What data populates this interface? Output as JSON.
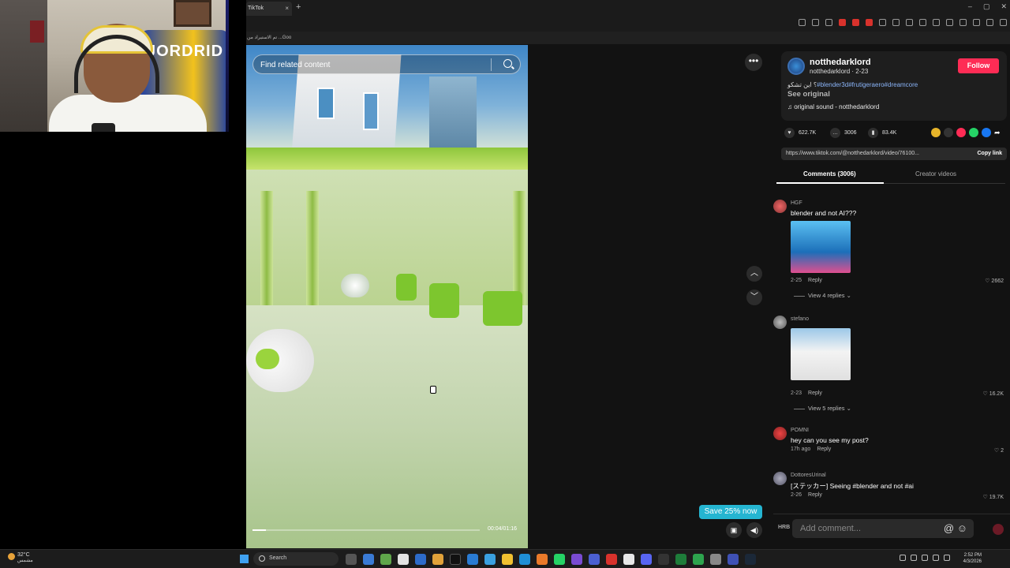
{
  "browser": {
    "tab_title": "TikTok",
    "tab_close": "×",
    "new_tab": "+",
    "window_controls": [
      "–",
      "▢",
      "✕"
    ],
    "bookmark_text": "تم الاستيراد من ...Goo"
  },
  "video": {
    "search_placeholder": "Find related content",
    "time": "00:04/01:16",
    "progress": 0.06
  },
  "controls": {
    "more": "•••",
    "up": "︿",
    "down": "﹀"
  },
  "post": {
    "display_name": "notthedarklord",
    "handle_line": "notthedarklord · 2-23",
    "follow_label": "Follow",
    "description_prefix": "؟ اين تشكو",
    "hashtags": "#blender3d#frutigeraero#dreamcore",
    "see_original": "See original",
    "sound": "♫  original sound - notthedarklord",
    "likes": "622.7K",
    "comments": "3006",
    "saves": "83.4K",
    "link": "https://www.tiktok.com/@notthedarklord/video/76100...",
    "copy_link": "Copy link"
  },
  "tabs": {
    "comments": "Comments (3006)",
    "creator_videos": "Creator videos"
  },
  "comments": [
    {
      "user": "HGF",
      "text": "blender and not AI???",
      "date": "2-25",
      "reply": "Reply",
      "likes": "2662",
      "replies": "View 4 replies ⌄"
    },
    {
      "user": "stefano",
      "text": "",
      "date": "2-23",
      "reply": "Reply",
      "likes": "16.2K",
      "replies": "View 5 replies ⌄"
    },
    {
      "user": "POMNI",
      "text": "hey can you see my post?",
      "date": "17h ago",
      "reply": "Reply",
      "likes": "2"
    },
    {
      "user": "DottoresUrinal",
      "text": "[ステッカー] Seeing #blender and not #ai",
      "date": "2-26",
      "reply": "Reply",
      "likes": "19.7K"
    }
  ],
  "add_comment": {
    "avatar_text": "HRB",
    "placeholder": "Add comment...",
    "icons": "@ ☺"
  },
  "save_banner": "Save 25% now",
  "taskbar": {
    "temp": "32°C",
    "weather_text": "مشمس",
    "search": "Search",
    "time": "2:52 PM",
    "date": "4/3/2026"
  }
}
